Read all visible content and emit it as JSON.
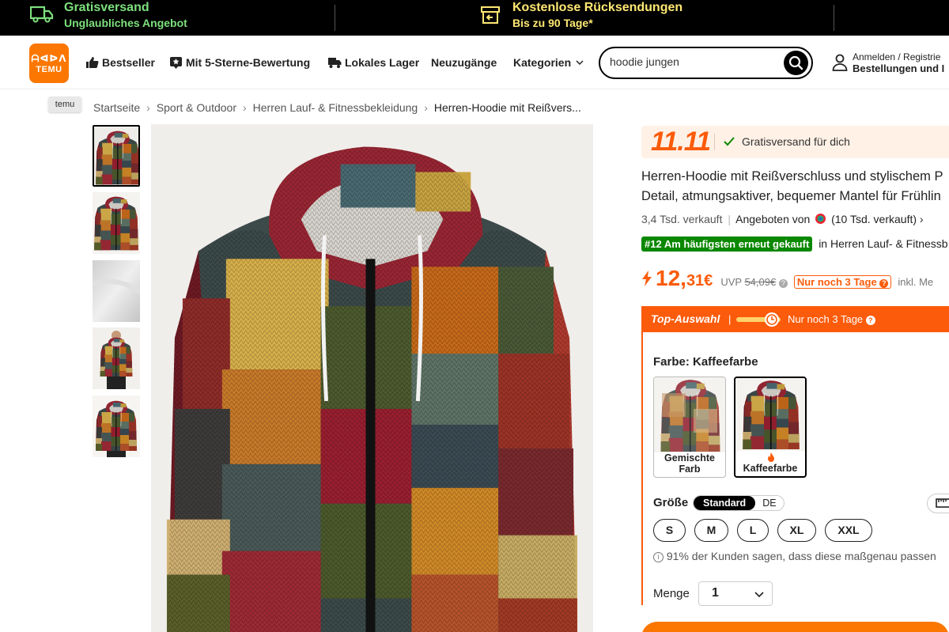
{
  "promo": {
    "free_shipping_title": "Gratisversand",
    "free_shipping_sub": "Unglaubliches Angebot",
    "returns_title": "Kostenlose Rücksendungen",
    "returns_sub": "Bis zu 90 Tage*"
  },
  "header": {
    "logo_line1": "ᗩᐊᐅᐱ",
    "logo_text": "TEMU",
    "nav": [
      "Bestseller",
      "Mit 5-Sterne-Bewertung",
      "Lokales Lager",
      "Neuzugänge",
      "Kategorien"
    ],
    "search_value": "hoodie jungen",
    "account_line1": "Anmelden / Registrie",
    "account_line2": "Bestellungen und I"
  },
  "tooltip": "temu",
  "breadcrumb": [
    "Startseite",
    "Sport & Outdoor",
    "Herren Lauf- & Fitnessbekleidung",
    "Herren-Hoodie mit Reißvers..."
  ],
  "product": {
    "deal_label": "11.11",
    "deal_text": "Gratisversand für dich",
    "title_line1": "Herren-Hoodie mit Reißverschluss und stylischem P",
    "title_line2": "Detail, atmungsaktiver, bequemer Mantel für Frühlin",
    "sold": "3,4 Tsd. verkauft",
    "offered_by": "Angeboten von",
    "seller_sold": "(10 Tsd. verkauft)",
    "rank_badge": "#12 Am häufigsten erneut gekauft",
    "rank_in": "in Herren Lauf- & Fitnessb",
    "price_int": "12,",
    "price_dec": "31€",
    "uvp_label": "UVP",
    "uvp_value": "54,09€",
    "limited": "Nur noch 3 Tage",
    "inkl": "inkl. Me",
    "top_selection": "Top-Auswahl",
    "top_days": "Nur noch 3 Tage",
    "farbe_label": "Farbe: Kaffeefarbe",
    "swatches": [
      {
        "label": "Gemischte Farb"
      },
      {
        "label": "Kaffeefarbe"
      }
    ],
    "size_label": "Größe",
    "size_standard": "Standard",
    "size_de": "DE",
    "sizes": [
      "S",
      "M",
      "L",
      "XL",
      "XXL"
    ],
    "fit_note": "91% der Kunden sagen, dass diese maßgenau passen",
    "menge_label": "Menge",
    "quantity": "1"
  },
  "colors": {
    "brand_orange": "#fb7701",
    "price_orange": "#fb5b0a",
    "promo_green": "#7de07d",
    "promo_yellow": "#ffe873",
    "rank_green": "#0a8800"
  }
}
